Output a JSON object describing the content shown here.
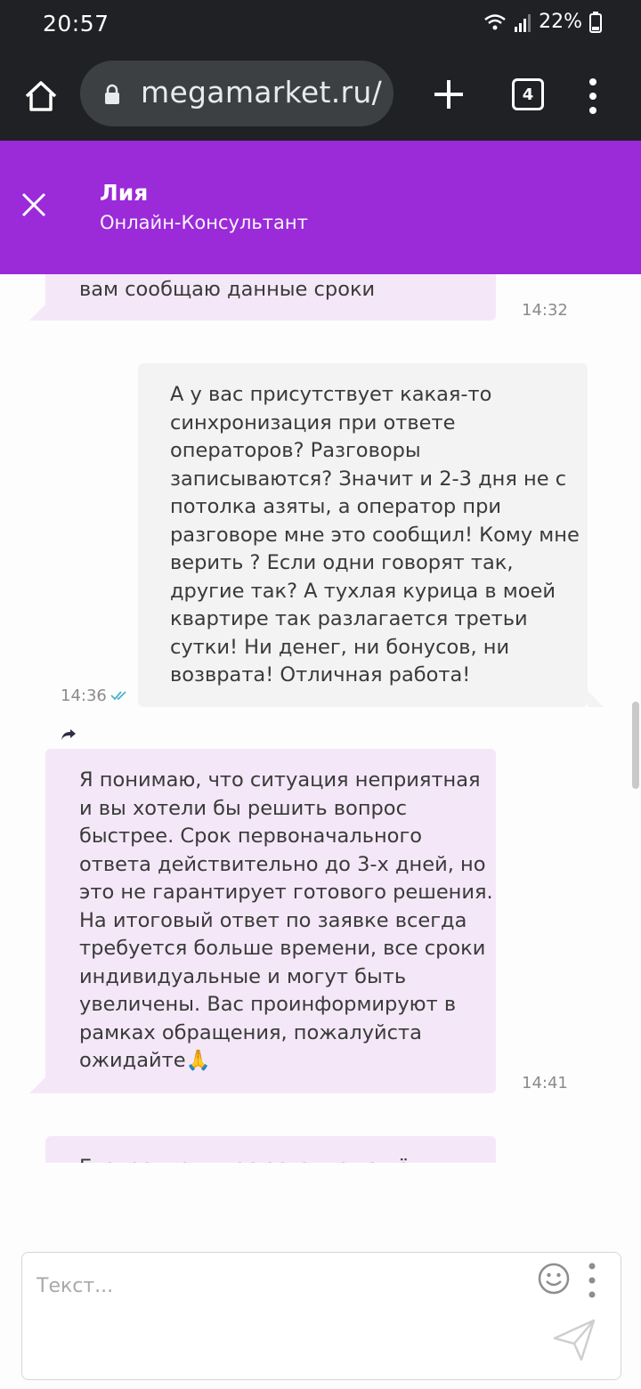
{
  "status": {
    "time": "20:57",
    "battery": "22%"
  },
  "browser": {
    "url": "megamarket.ru/",
    "tab_count": "4"
  },
  "header": {
    "agent_name": "Лия",
    "agent_role": "Онлайн-Консультант"
  },
  "messages": [
    {
      "text": "вам сообщаю данные сроки",
      "time": "14:32"
    },
    {
      "text": "А у вас присутствует какая-то\nсинхронизация при ответе\nоператоров? Разговоры\nзаписываются? Значит и 2-3 дня не с\nпотолка азяты, а оператор при\nразговоре мне это сообщил! Кому мне\nверить ? Если одни говорят так,\nдругие так? А тухлая курица в моей\nквартире так разлагается третьи\nсутки! Ни денег, ни бонусов, ни\nвозврата! Отличная работа!",
      "time": "14:36"
    },
    {
      "text": "Я понимаю, что ситуация неприятная\nи вы хотели бы решить вопрос\nбыстрее. Срок первоначального\nответа действительно до 3-х дней, но\nэто не гарантирует готового решения.\nНа итоговый ответ по заявке всегда\nтребуется больше времени, все сроки\nиндивидуальные и могут быть\nувеличены. Вас проинформируют в\nрамках обращения, пожалуйста\nожидайте🙏",
      "time": "14:41"
    },
    {
      "text": "Екатерина, у вас остались ещё"
    }
  ],
  "composer": {
    "placeholder": "Текст..."
  },
  "colors": {
    "header": "#9b2ad9",
    "incoming_bubble": "#f4e8f8",
    "outgoing_bubble": "#f3f3f3",
    "read_ticks": "#4ab3c9"
  }
}
